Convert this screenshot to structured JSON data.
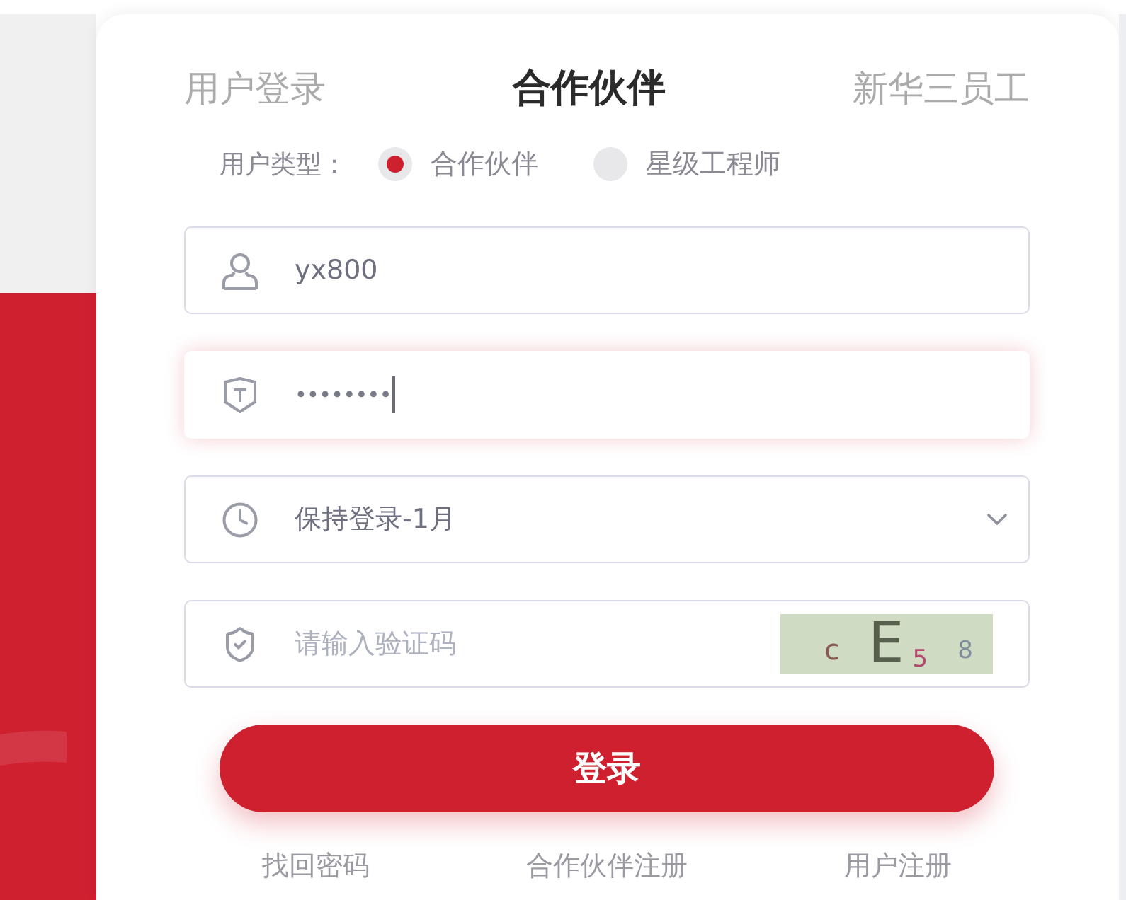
{
  "tabs": [
    {
      "label": "用户登录",
      "selected": false
    },
    {
      "label": "合作伙伴",
      "selected": true
    },
    {
      "label": "新华三员工",
      "selected": false
    }
  ],
  "user_type": {
    "label": "用户类型：",
    "options": [
      {
        "label": "合作伙伴",
        "selected": true
      },
      {
        "label": "星级工程师",
        "selected": false
      }
    ]
  },
  "fields": [
    {
      "kind": "text",
      "value": "yx800",
      "focused": false
    },
    {
      "kind": "password",
      "value": "••••••••",
      "focused": true
    },
    {
      "kind": "select",
      "value": "保持登录-1月",
      "focused": false
    },
    {
      "kind": "captcha",
      "placeholder": "请输入验证码",
      "focused": false,
      "captcha": [
        {
          "char": "c",
          "color": "#8a5a52"
        },
        {
          "char": "E",
          "color": "#56604c"
        },
        {
          "char": "5",
          "color": "#b3476e"
        },
        {
          "char": "8",
          "color": "#7f8c9c"
        }
      ]
    }
  ],
  "login_button": "登录",
  "links": [
    "找回密码",
    "合作伙伴注册",
    "用户注册"
  ]
}
